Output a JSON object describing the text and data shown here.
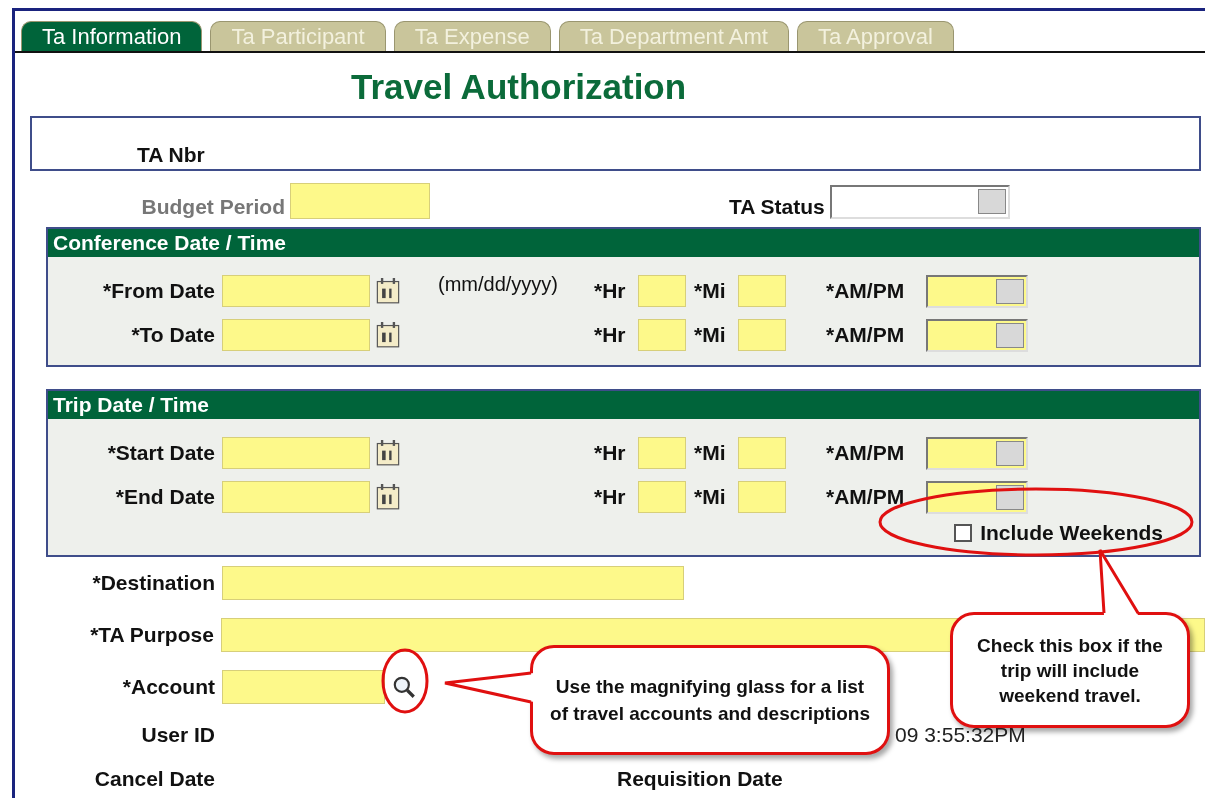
{
  "tabs": [
    {
      "label": "Ta Information",
      "selected": true
    },
    {
      "label": "Ta Participant",
      "selected": false
    },
    {
      "label": "Ta Expense",
      "selected": false
    },
    {
      "label": "Ta Department Amt",
      "selected": false
    },
    {
      "label": "Ta Approval",
      "selected": false
    }
  ],
  "title": "Travel Authorization",
  "ta_nbr": {
    "label": "TA Nbr"
  },
  "budget_period": {
    "label": "Budget Period",
    "disabled": true
  },
  "ta_status": {
    "label": "TA Status"
  },
  "sections": [
    {
      "title": "Conference Date / Time",
      "rows": [
        {
          "date_label": "*From Date",
          "hint": "(mm/dd/yyyy)",
          "hr_label": "*Hr",
          "mi_label": "*Mi",
          "ampm_label": "*AM/PM"
        },
        {
          "date_label": "*To Date",
          "hr_label": "*Hr",
          "mi_label": "*Mi",
          "ampm_label": "*AM/PM"
        }
      ]
    },
    {
      "title": "Trip Date / Time",
      "rows": [
        {
          "date_label": "*Start Date",
          "hr_label": "*Hr",
          "mi_label": "*Mi",
          "ampm_label": "*AM/PM"
        },
        {
          "date_label": "*End Date",
          "hr_label": "*Hr",
          "mi_label": "*Mi",
          "ampm_label": "*AM/PM"
        }
      ],
      "checkbox": {
        "label": "Include Weekends",
        "checked": false
      }
    }
  ],
  "destination": {
    "label": "*Destination"
  },
  "purpose": {
    "label": "*TA Purpose"
  },
  "account": {
    "label": "*Account"
  },
  "user_id": {
    "label": "User ID",
    "value": "09  3:55:32PM"
  },
  "cancel_date": {
    "label": "Cancel Date"
  },
  "requisition_date": {
    "label": "Requisition Date"
  },
  "callouts": [
    {
      "text": "Use the magnifying glass for a list of travel accounts and descriptions"
    },
    {
      "text": "Check this box if the trip will include weekend travel."
    }
  ]
}
